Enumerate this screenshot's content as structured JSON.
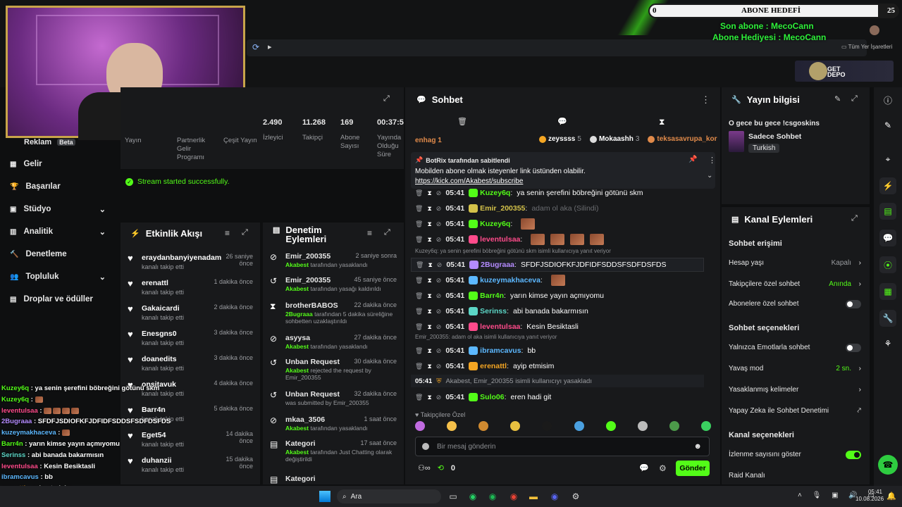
{
  "overlay": {
    "sub_goal_count": "0",
    "sub_goal_title": "ABONE HEDEFİ",
    "sub_goal_target": "25",
    "last_sub": "Son abone : MecoCann",
    "gift_sub": "Abone Hediyesi : MecoCann",
    "bookmarks": "Tüm Yer İşaretleri",
    "ad_text": "GET DEPO"
  },
  "stats": [
    {
      "value": "",
      "label": "Yayın"
    },
    {
      "value": "",
      "label": "Partnerlik Gelir Programı"
    },
    {
      "value": "",
      "label": "Çeşit Yayın"
    },
    {
      "value": "2.490",
      "label": "İzleyici"
    },
    {
      "value": "11.268",
      "label": "Takipçi"
    },
    {
      "value": "169",
      "label": "Abone Sayısı"
    },
    {
      "value": "00:37:5",
      "label": "Yayında Olduğu Süre"
    }
  ],
  "success_msg": "Stream started successfully.",
  "nav": {
    "reklam": "Reklam",
    "beta": "Beta",
    "items": [
      "Gelir",
      "Başarılar",
      "Stüdyo",
      "Analitik",
      "Denetleme",
      "Topluluk",
      "Droplar ve ödüller"
    ]
  },
  "activity": {
    "title": "Etkinlik Akışı",
    "items": [
      {
        "name": "eraydanbanyiyenadam",
        "sub": "kanalı takip etti",
        "time": "26 saniye önce"
      },
      {
        "name": "erenattl",
        "sub": "kanalı takip etti",
        "time": "1 dakika önce"
      },
      {
        "name": "Gakaicardi",
        "sub": "kanalı takip etti",
        "time": "2 dakika önce"
      },
      {
        "name": "Enesgns0",
        "sub": "kanalı takip etti",
        "time": "3 dakika önce"
      },
      {
        "name": "doanedits",
        "sub": "kanalı takip etti",
        "time": "3 dakika önce"
      },
      {
        "name": "onsitavuk",
        "sub": "kanalı takip etti",
        "time": "4 dakika önce"
      },
      {
        "name": "Barr4n",
        "sub": "kanalı takip etti",
        "time": "5 dakika önce"
      },
      {
        "name": "Eget54",
        "sub": "kanalı takip etti",
        "time": "14 dakika önce"
      },
      {
        "name": "duhanzii",
        "sub": "kanalı takip etti",
        "time": "15 dakika önce"
      }
    ]
  },
  "modactions": {
    "title": "Denetim Eylemleri",
    "items": [
      {
        "name": "Emir_200355",
        "actor": "Akabest",
        "sub": "tarafından yasaklandı",
        "time": "2 saniye sonra"
      },
      {
        "name": "Emir_200355",
        "actor": "Akabest",
        "sub": "tarafından yasağı kaldırıldı",
        "time": "45 saniye önce"
      },
      {
        "name": "brotherBABOS",
        "actor": "2Bugraaa",
        "sub": "tarafından 5 dakika süreliğine sohbetten uzaklaştırıldı",
        "time": "22 dakika önce"
      },
      {
        "name": "asyysa",
        "actor": "Akabest",
        "sub": "tarafından yasaklandı",
        "time": "27 dakika önce"
      },
      {
        "name": "Unban Request",
        "actor": "Akabest",
        "sub": "rejected the request by Emir_200355",
        "time": "30 dakika önce"
      },
      {
        "name": "Unban Request",
        "actor": "",
        "sub": "was submitted by Emir_200355",
        "time": "32 dakika önce"
      },
      {
        "name": "mkaa_3506",
        "actor": "Akabest",
        "sub": "tarafından yasaklandı",
        "time": "1 saat önce"
      },
      {
        "name": "Kategori",
        "actor": "Akabest",
        "sub": "tarafından Just Chatting olarak değiştirildi",
        "time": "17 saat önce"
      },
      {
        "name": "Kategori",
        "actor": "",
        "sub": "",
        "time": ""
      }
    ]
  },
  "chat": {
    "title": "Sohbet",
    "top_gifters": [
      {
        "name": "zeyssss",
        "count": "5"
      },
      {
        "name": "Mokaashh",
        "count": "3"
      },
      {
        "name": "teksasavrupa_kor",
        "count": ""
      }
    ],
    "top_left": "enhag 1",
    "pinned_by": "BotRix tarafından sabitlendi",
    "pinned_text": "Mobilden abone olmak isteyenler link üstünden olabilir.",
    "pinned_link": "https://kick.com/Akabest/subscribe",
    "messages": [
      {
        "time": "05:41",
        "user": "Kuzey6q",
        "color": "#53fc18",
        "text": "ya senin şerefini böbreğini götünü skm"
      },
      {
        "time": "05:41",
        "user": "Emir_200355",
        "color": "#d4c24a",
        "text": "adam ol aka (Silindi)"
      },
      {
        "time": "05:41",
        "user": "Kuzey6q",
        "color": "#53fc18",
        "text": ""
      },
      {
        "time": "05:41",
        "user": "leventulsaa",
        "color": "#ff4b8b",
        "text": ""
      },
      {
        "time": "05:41",
        "user": "2Bugraaa",
        "color": "#b48bff",
        "text": "SFDFJSDIOFKFJDFIDFSDDSFSDFDSFDS",
        "reply": "Kuzey6q: ya senin şerefini böbreğini götünü skm isimli kullanıcıya yanıt veriyor"
      },
      {
        "time": "05:41",
        "user": "kuzeymakhaceva",
        "color": "#5cb8ff",
        "text": ""
      },
      {
        "time": "05:41",
        "user": "Barr4n",
        "color": "#53fc18",
        "text": "yarın kimse yayın açmıyomu"
      },
      {
        "time": "05:41",
        "user": "Serinss",
        "color": "#5cd6c6",
        "text": "abi banada bakarmısın"
      },
      {
        "time": "05:41",
        "user": "leventulsaa",
        "color": "#ff4b8b",
        "text": "Kesin Besiktasli"
      },
      {
        "time": "05:41",
        "user": "ibramcavus",
        "color": "#5cb8ff",
        "text": "bb",
        "reply": "Emir_200355: adam ol aka isimli kullanıcıya yanıt veriyor"
      },
      {
        "time": "05:41",
        "user": "erenattl",
        "color": "#f5a623",
        "text": "ayip etmisim"
      },
      {
        "time": "05:41",
        "user": "Sulo06",
        "color": "#53fc18",
        "text": "eren hadi git"
      }
    ],
    "system_msg_time": "05:41",
    "system_msg": "Akabest, Emir_200355 isimli kullanıcıyı yasakladı",
    "followers_only": "Takipçilere Özel",
    "input_placeholder": "Bir mesaj gönderin",
    "points": "0",
    "send_label": "Gönder"
  },
  "stream_info": {
    "title": "Yayın bilgisi",
    "stream_title": "O gece bu gece !csgoskins",
    "category": "Sadece Sohbet",
    "language": "Turkish"
  },
  "channel_actions": {
    "title": "Kanal Eylemleri",
    "chat_access": "Sohbet erişimi",
    "account_age": "Hesap yaşı",
    "account_age_val": "Kapalı",
    "followers_chat": "Takipçilere özel sohbet",
    "followers_chat_val": "Anında",
    "subs_chat": "Abonelere özel sohbet",
    "chat_options": "Sohbet seçenekleri",
    "emotes_only": "Yalnızca Emotlarla sohbet",
    "slow_mode": "Yavaş mod",
    "slow_mode_val": "2 sn.",
    "banned_words": "Yasaklanmış kelimeler",
    "ai_moderation": "Yapay Zeka ile Sohbet Denetimi",
    "channel_options": "Kanal seçenekleri",
    "show_viewers": "İzlenme sayısını göster",
    "raid": "Raid Kanalı"
  },
  "overlay_chat": [
    {
      "user": "Kuzey6q",
      "color": "#53fc18",
      "text": "ya senin şerefini böbreğini götünü skm"
    },
    {
      "user": "Kuzey6q",
      "color": "#53fc18",
      "text": ""
    },
    {
      "user": "leventulsaa",
      "color": "#ff4b8b",
      "text": ""
    },
    {
      "user": "2Bugraaa",
      "color": "#b48bff",
      "text": "SFDFJSDIOFKFJDFIDFSDDSFSDFDSFDS"
    },
    {
      "user": "kuzeymakhaceva",
      "color": "#5cb8ff",
      "text": ""
    },
    {
      "user": "Barr4n",
      "color": "#53fc18",
      "text": "yarın kimse yayın açmıyomu"
    },
    {
      "user": "Serinss",
      "color": "#5cd6c6",
      "text": "abi banada bakarmısın"
    },
    {
      "user": "leventulsaa",
      "color": "#ff4b8b",
      "text": "Kesin Besiktasli"
    },
    {
      "user": "ibramcavus",
      "color": "#5cb8ff",
      "text": "bb"
    },
    {
      "user": "erenattl",
      "color": "#f5a623",
      "text": "ayip etmisim"
    },
    {
      "user": "Sulo06",
      "color": "#53fc18",
      "text": "eren hadi git"
    }
  ],
  "taskbar": {
    "search": "Ara",
    "time": "05:41",
    "date": "10.08.2026"
  }
}
